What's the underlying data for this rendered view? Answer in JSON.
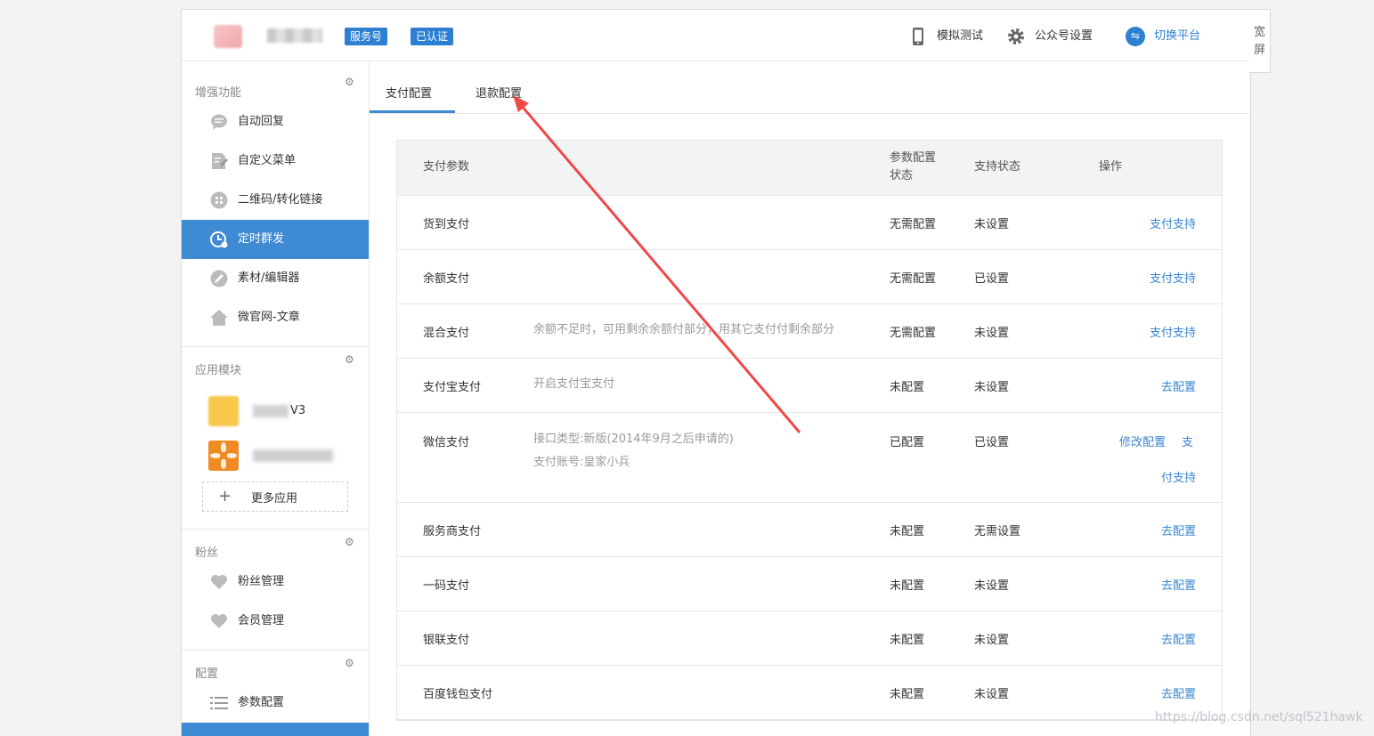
{
  "header": {
    "badges": [
      "服务号",
      "已认证"
    ],
    "simulate_label": "模拟测试",
    "settings_label": "公众号设置",
    "switch_label": "切换平台",
    "switch_icon_glyph": "⇋"
  },
  "wide_toggle": {
    "line1": "宽",
    "line2": "屏"
  },
  "sidebar": {
    "sections": [
      {
        "title": "增强功能",
        "items": [
          "自动回复",
          "自定义菜单",
          "二维码/转化链接",
          "定时群发",
          "素材/编辑器",
          "微官网-文章"
        ]
      },
      {
        "title": "应用模块",
        "apps": [
          "V3"
        ],
        "more_label": "更多应用"
      },
      {
        "title": "粉丝",
        "items": [
          "粉丝管理",
          "会员管理"
        ]
      },
      {
        "title": "配置",
        "items": [
          "参数配置"
        ]
      }
    ],
    "active_item": "定时群发",
    "plus_glyph": "+"
  },
  "tabs": [
    "支付配置",
    "退款配置"
  ],
  "table": {
    "headers": {
      "param": "支付参数",
      "config_status_line1": "参数配置",
      "config_status_line2": "状态",
      "support_status": "支持状态",
      "action": "操作"
    },
    "rows": [
      {
        "name": "货到支付",
        "desc": "",
        "config": "无需配置",
        "support": "未设置",
        "action": "支付支持"
      },
      {
        "name": "余额支付",
        "desc": "",
        "config": "无需配置",
        "support": "已设置",
        "action": "支付支持"
      },
      {
        "name": "混合支付",
        "desc": "余额不足时，可用剩余余额付部分，用其它支付付剩余部分",
        "config": "无需配置",
        "support": "未设置",
        "action": "支付支持"
      },
      {
        "name": "支付宝支付",
        "desc": "开启支付宝支付",
        "config": "未配置",
        "support": "未设置",
        "action": "去配置"
      },
      {
        "name": "微信支付",
        "desc": "接口类型:新版(2014年9月之后申请的)",
        "desc2": "支付账号:皇家小兵",
        "config": "已配置",
        "support": "已设置",
        "action": "修改配置",
        "action2_a": "支",
        "action2_b": "付支持"
      },
      {
        "name": "服务商支付",
        "desc": "",
        "config": "未配置",
        "support": "无需设置",
        "action": "去配置"
      },
      {
        "name": "一码支付",
        "desc": "",
        "config": "未配置",
        "support": "未设置",
        "action": "去配置"
      },
      {
        "name": "银联支付",
        "desc": "",
        "config": "未配置",
        "support": "未设置",
        "action": "去配置"
      },
      {
        "name": "百度钱包支付",
        "desc": "",
        "config": "未配置",
        "support": "未设置",
        "action": "去配置"
      }
    ]
  },
  "watermark": "https://blog.csdn.net/sql521hawk",
  "colors": {
    "accent": "#3e8ad3",
    "link": "#3a86d2",
    "annotation": "#f04848"
  }
}
